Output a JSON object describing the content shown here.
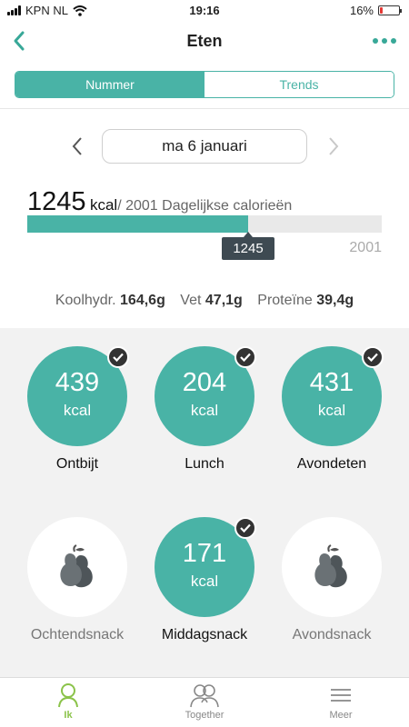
{
  "status_bar": {
    "carrier": "KPN NL",
    "time": "19:16",
    "battery": "16%",
    "battery_level": 0.16
  },
  "nav": {
    "title": "Eten"
  },
  "segments": {
    "active": "Nummer",
    "inactive": "Trends"
  },
  "date": {
    "label": "ma 6 januari"
  },
  "calories": {
    "consumed": "1245",
    "unit": "kcal",
    "goal_text": "/ 2001 Dagelijkse calorieën",
    "progress_fraction": 0.622,
    "tooltip": "1245",
    "goal_label": "2001"
  },
  "macros": {
    "carbs_label": "Koolhydr.",
    "carbs_value": "164,6g",
    "fat_label": "Vet",
    "fat_value": "47,1g",
    "protein_label": "Proteïne",
    "protein_value": "39,4g"
  },
  "meals": [
    {
      "label": "Ontbijt",
      "value": "439",
      "unit": "kcal",
      "logged": true
    },
    {
      "label": "Lunch",
      "value": "204",
      "unit": "kcal",
      "logged": true
    },
    {
      "label": "Avondeten",
      "value": "431",
      "unit": "kcal",
      "logged": true
    },
    {
      "label": "Ochtendsnack",
      "value": "",
      "unit": "",
      "logged": false,
      "icon": "pear-icon"
    },
    {
      "label": "Middagsnack",
      "value": "171",
      "unit": "kcal",
      "logged": true
    },
    {
      "label": "Avondsnack",
      "value": "",
      "unit": "",
      "logged": false,
      "icon": "pear-icon"
    }
  ],
  "tabs": [
    {
      "label": "Ik",
      "icon": "person-icon",
      "active": true
    },
    {
      "label": "Together",
      "icon": "people-icon",
      "active": false
    },
    {
      "label": "Meer",
      "icon": "menu-icon",
      "active": false
    }
  ],
  "colors": {
    "accent": "#49b3a6",
    "tab_active": "#8bc34a",
    "tooltip": "#3e4a52",
    "battery_low": "#e53935"
  }
}
